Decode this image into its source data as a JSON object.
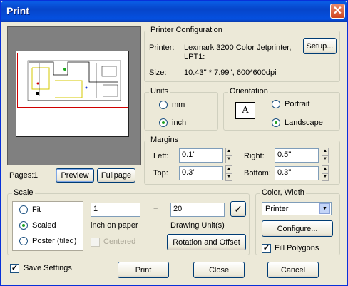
{
  "window": {
    "title": "Print",
    "close_symbol": "✕"
  },
  "preview": {
    "pages_label": "Pages:",
    "pages_value": "1",
    "preview_button": "Preview",
    "fullpage_button": "Fullpage"
  },
  "printer_config": {
    "group_label": "Printer Configuration",
    "printer_label": "Printer:",
    "printer_name": "Lexmark 3200 Color Jetprinter, LPT1:",
    "size_label": "Size:",
    "size_value": "10.43'' * 7.99'', 600*600dpi",
    "setup_button": "Setup..."
  },
  "units": {
    "group_label": "Units",
    "options": [
      "mm",
      "inch"
    ],
    "selected": "inch"
  },
  "orientation": {
    "group_label": "Orientation",
    "icon_letter": "A",
    "options": [
      "Portrait",
      "Landscape"
    ],
    "selected": "Landscape"
  },
  "margins": {
    "group_label": "Margins",
    "left_label": "Left:",
    "left_value": "0.1''",
    "right_label": "Right:",
    "right_value": "0.5''",
    "top_label": "Top:",
    "top_value": "0.3''",
    "bottom_label": "Bottom:",
    "bottom_value": "0.3''"
  },
  "scale": {
    "group_label": "Scale",
    "options": [
      "Fit",
      "Scaled",
      "Poster (tiled)"
    ],
    "selected": "Scaled",
    "paper_value": "1",
    "paper_caption": "inch on paper",
    "equals": "=",
    "drawing_value": "20",
    "drawing_caption": "Drawing Unit(s)",
    "apply_symbol": "✓",
    "centered_label": "Centered",
    "rotation_button": "Rotation and Offset"
  },
  "color_width": {
    "group_label": "Color, Width",
    "select_value": "Printer",
    "configure_button": "Configure...",
    "fill_polygons_label": "Fill Polygons",
    "fill_polygons_checked": true
  },
  "footer": {
    "save_settings_label": "Save Settings",
    "save_settings_checked": true,
    "print_button": "Print",
    "close_button": "Close",
    "cancel_button": "Cancel"
  },
  "colors": {
    "title_bar": "#0645c9",
    "window_bg": "#ece9d8",
    "preview_bg": "#808080",
    "print_area": "#d00000"
  }
}
